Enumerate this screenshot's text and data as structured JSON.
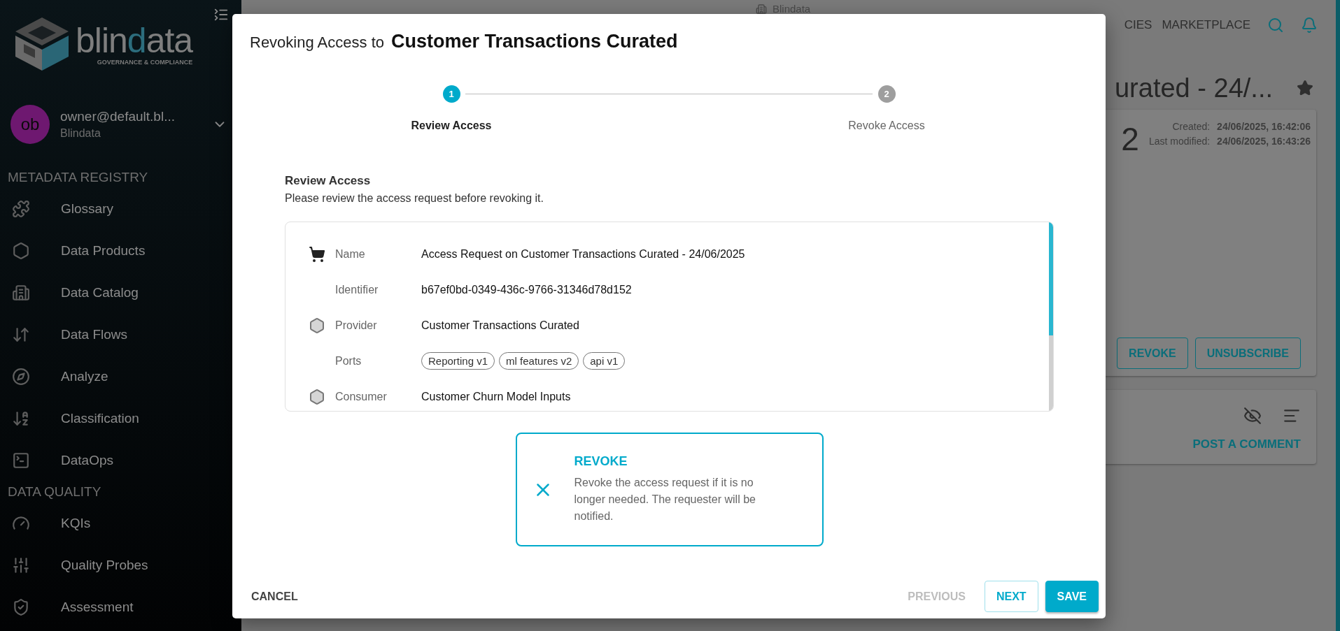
{
  "sidebar": {
    "logo": {
      "parts": [
        {
          "text": "blin",
          "accent": false
        },
        {
          "text": "d",
          "accent": true
        },
        {
          "text": "ata",
          "accent": false
        }
      ],
      "tagline": "GOVERNANCE & COMPLIANCE"
    },
    "user": {
      "initials": "ob",
      "email": "owner@default.bl...",
      "tenant": "Blindata"
    },
    "sections": [
      {
        "title": "METADATA REGISTRY",
        "items": [
          {
            "label": "Glossary"
          },
          {
            "label": "Data Products"
          },
          {
            "label": "Data Catalog"
          },
          {
            "label": "Data Flows"
          },
          {
            "label": "Analyze"
          },
          {
            "label": "Classification"
          },
          {
            "label": "DataOps"
          }
        ]
      },
      {
        "title": "DATA QUALITY",
        "items": [
          {
            "label": "KQIs"
          },
          {
            "label": "Quality Probes"
          },
          {
            "label": "Assessment"
          }
        ]
      }
    ]
  },
  "page": {
    "breadcrumb": "Blindata",
    "nav": [
      "CIES",
      "MARKETPLACE"
    ],
    "title": "urated - 24/...",
    "version": "2",
    "meta": [
      {
        "label": "Created:",
        "value": "24/06/2025, 16:42:06"
      },
      {
        "label": "Last modified:",
        "value": "24/06/2025, 16:43:26"
      }
    ],
    "actions": [
      "REVOKE",
      "UNSUBSCRIBE"
    ],
    "comment_action": "POST A COMMENT"
  },
  "dialog": {
    "title": "Revoking Access to",
    "subject": "Customer Transactions Curated",
    "steps": [
      {
        "number": "1",
        "label": "Review Access",
        "selected": true
      },
      {
        "number": "2",
        "label": "Revoke Access",
        "selected": false
      }
    ],
    "heading": "Review Access",
    "subtitle": "Please review the access request before revoking it.",
    "details": [
      {
        "kind": "text",
        "label": "Name",
        "value": "Access Request on Customer Transactions Curated - 24/06/2025"
      },
      {
        "kind": "text",
        "label": "Identifier",
        "value": "b67ef0bd-0349-436c-9766-31346d78d152"
      },
      {
        "kind": "text",
        "label": "Provider",
        "value": "Customer Transactions Curated"
      },
      {
        "kind": "chips",
        "label": "Ports",
        "chips": [
          "Reporting v1",
          "ml features v2",
          "api v1"
        ]
      },
      {
        "kind": "text",
        "label": "Consumer",
        "value": "Customer Churn Model Inputs"
      }
    ],
    "option": {
      "title": "REVOKE",
      "description": "Revoke the access request if it is no longer needed. The requester will be notified.",
      "selected": true
    },
    "cancel": "CANCEL",
    "buttons": [
      {
        "label": "PREVIOUS",
        "kind": "text",
        "disabled": true
      },
      {
        "label": "NEXT",
        "kind": "outlined",
        "disabled": false
      },
      {
        "label": "SAVE",
        "kind": "contained",
        "disabled": false
      }
    ]
  }
}
